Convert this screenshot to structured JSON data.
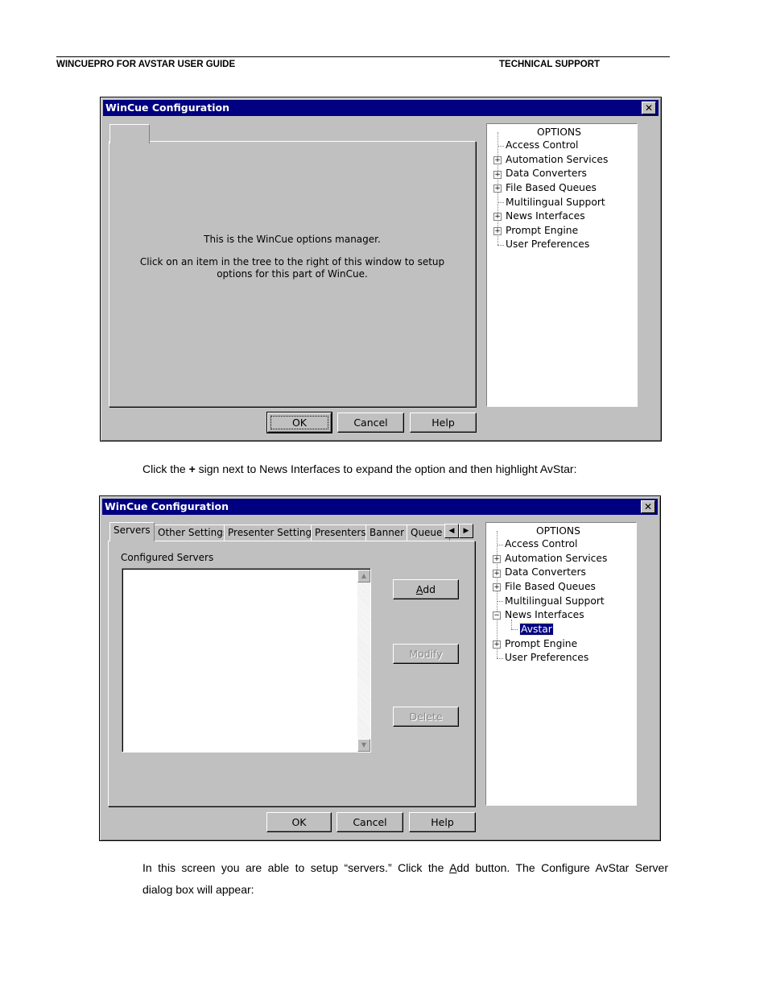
{
  "header": {
    "left": "WINCUEPRO FOR AVSTAR USER GUIDE",
    "right": "TECHNICAL SUPPORT"
  },
  "dialog1": {
    "title": "WinCue Configuration",
    "close_glyph": "✕",
    "message_line1": "This is the WinCue options manager.",
    "message_line2": "Click on an item in the tree to the right of this window to setup",
    "message_line3": "options for this part of WinCue.",
    "ok": "OK",
    "cancel": "Cancel",
    "help": "Help",
    "tree": {
      "heading": "OPTIONS",
      "items": [
        "Access Control",
        "Automation Services",
        "Data Converters",
        "File Based Queues",
        "Multilingual Support",
        "News Interfaces",
        "Prompt Engine",
        "User Preferences"
      ]
    }
  },
  "instruction1": {
    "before": "Click the ",
    "bold": "+",
    "after": " sign next to News Interfaces to expand the option and then highlight AvStar:"
  },
  "dialog2": {
    "title": "WinCue Configuration",
    "close_glyph": "✕",
    "tabs": [
      "Servers",
      "Other Settings",
      "Presenter Settings",
      "Presenters",
      "Banner",
      "Queue L"
    ],
    "configured_servers_label": "Configured Servers",
    "add": "Add",
    "modify": "Modify",
    "delete": "Delete",
    "ok": "OK",
    "cancel": "Cancel",
    "help": "Help",
    "tree": {
      "heading": "OPTIONS",
      "items": [
        "Access Control",
        "Automation Services",
        "Data Converters",
        "File Based Queues",
        "Multilingual Support",
        "News Interfaces",
        "Avstar",
        "Prompt Engine",
        "User Preferences"
      ]
    }
  },
  "instruction2": {
    "line1_a": "In this screen you are able to setup “servers.”  Click the ",
    "line1_u": "A",
    "line1_b": "dd button.  The Configure AvStar Server",
    "line2": "dialog box will appear:"
  }
}
